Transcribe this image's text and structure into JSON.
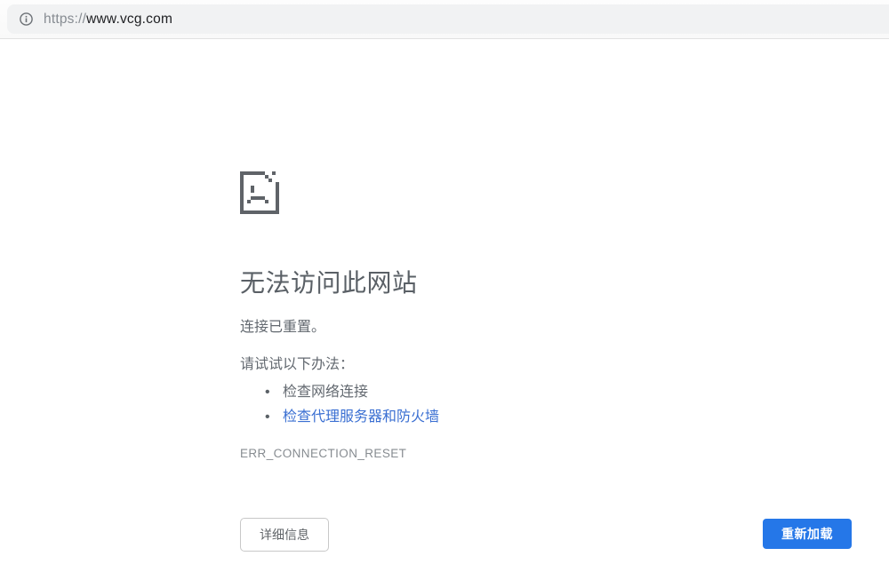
{
  "browser": {
    "url_scheme": "https://",
    "url_host": "www.vcg.com",
    "info_icon": "info-circle-icon"
  },
  "error_page": {
    "title": "无法访问此网站",
    "message": "连接已重置。",
    "suggestion_heading": "请试试以下办法：",
    "suggestions": [
      {
        "label": "检查网络连接",
        "is_link": false
      },
      {
        "label": "检查代理服务器和防火墙",
        "is_link": true
      }
    ],
    "error_code": "ERR_CONNECTION_RESET",
    "sad_page_icon": "sad-file-icon"
  },
  "buttons": {
    "details_label": "详细信息",
    "reload_label": "重新加载"
  },
  "colors": {
    "link": "#3a6fd2",
    "reload_button_bg": "#2577e8",
    "icon_gray": "#5f6368",
    "omnibox_bg": "#f1f2f3"
  }
}
